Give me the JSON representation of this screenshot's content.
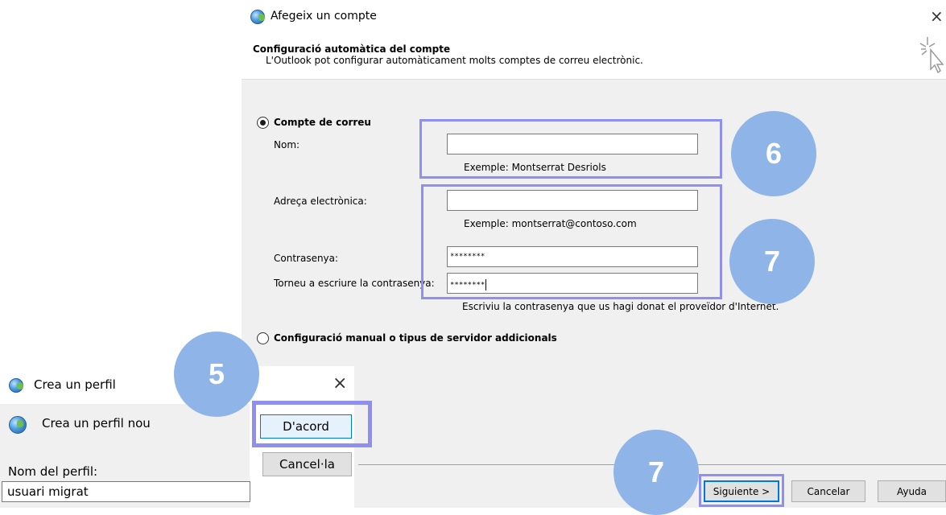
{
  "dialog": {
    "title": "Afegeix un compte",
    "close_glyph": "×",
    "header_title": "Configuració automàtica del compte",
    "header_subtitle": "L'Outlook pot configurar automàticament molts comptes de correu electrònic.",
    "header_icon": "cursor-sparkle-icon"
  },
  "email_account": {
    "radio_label": "Compte de correu",
    "name_label": "Nom:",
    "name_value": "",
    "name_example": "Exemple: Montserrat Desriols",
    "email_label": "Adreça electrònica:",
    "email_value": "",
    "email_example": "Exemple: montserrat@contoso.com",
    "password_label": "Contrasenya:",
    "password_value": "********",
    "retype_label": "Torneu a escriure la contrasenya:",
    "retype_value": "********",
    "password_hint": "Escriviu la contrasenya que us hagi donat el proveïdor d'Internet."
  },
  "manual_config": {
    "radio_label": "Configuració manual o tipus de servidor addicionals"
  },
  "footer": {
    "next_label": "Siguiente >",
    "cancel_label": "Cancelar",
    "help_label": "Ayuda"
  },
  "create_profile": {
    "title": "Crea un perfil",
    "close_glyph": "×",
    "subtitle": "Crea un perfil nou",
    "name_label": "Nom del perfil:",
    "name_value": "usuari migrat",
    "ok_label": "D'acord",
    "cancel_label": "Cancel·la"
  },
  "callouts": {
    "step5": "5",
    "step6": "6",
    "step7a": "7",
    "step7b": "7",
    "color": "#8eb4e8",
    "highlight_color": "#8f8ff0"
  }
}
